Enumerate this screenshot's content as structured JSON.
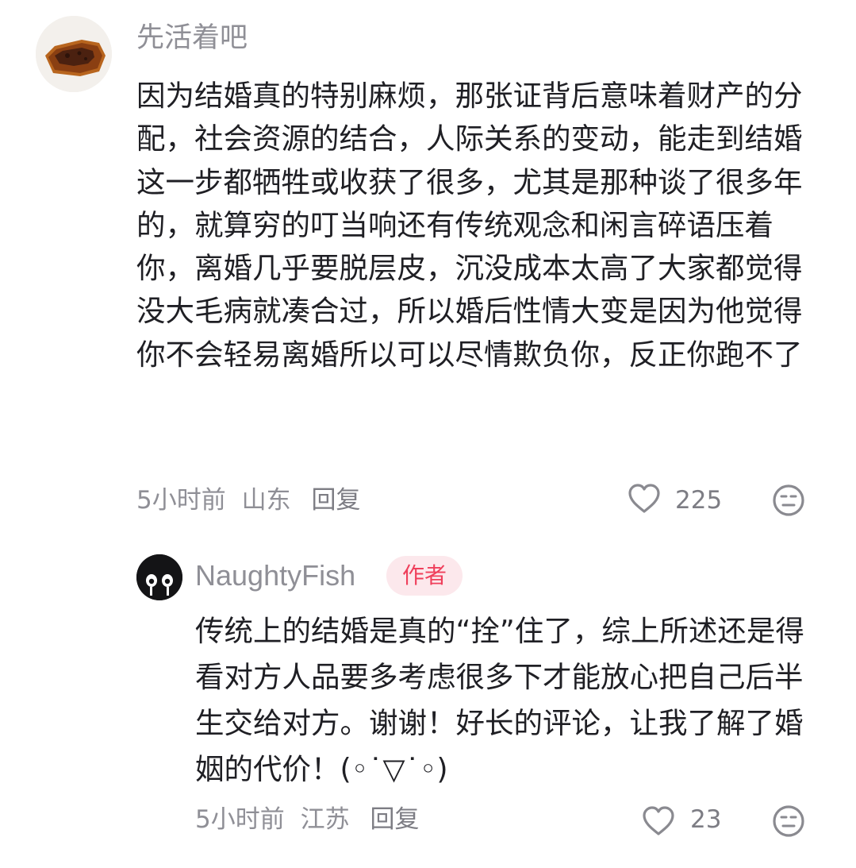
{
  "comment": {
    "username": "先活着吧",
    "avatar_icon": "toast-avatar-icon",
    "text": "因为结婚真的特别麻烦，那张证背后意味着财产的分配，社会资源的结合，人际关系的变动，能走到结婚这一步都牺牲或收获了很多，尤其是那种谈了很多年的，就算穷的叮当响还有传统观念和闲言碎语压着你，离婚几乎要脱层皮，沉没成本太高了大家都觉得没大毛病就凑合过，所以婚后性情大变是因为他觉得你不会轻易离婚所以可以尽情欺负你，反正你跑不了",
    "time": "5小时前",
    "location": "山东",
    "reply_label": "回复",
    "like_count": "225"
  },
  "reply": {
    "username": "NaughtyFish",
    "author_badge": "作者",
    "avatar_icon": "black-cat-avatar-icon",
    "text": "传统上的结婚是真的“拴”住了，综上所述还是得看对方人品要多考虑很多下才能放心把自己后半生交给对方。谢谢！好长的评论，让我了解了婚姻的代价！(◦˙▽˙◦)",
    "time": "5小时前",
    "location": "江苏",
    "reply_label": "回复",
    "like_count": "23"
  },
  "colors": {
    "background": "#ffffff",
    "text": "#1f1f24",
    "muted": "#8f8f96",
    "badge_bg": "#fce8ec",
    "badge_text": "#ef3f5b"
  }
}
